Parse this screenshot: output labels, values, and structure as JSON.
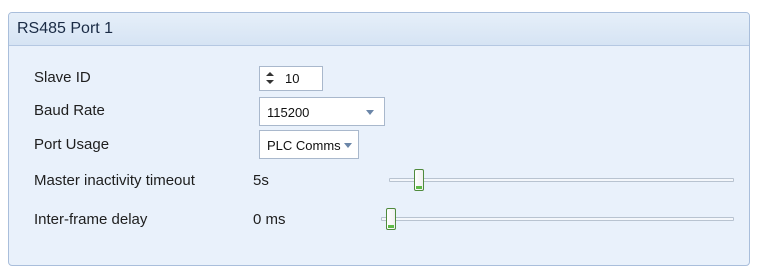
{
  "panel": {
    "title": "RS485 Port 1"
  },
  "slave_id": {
    "label": "Slave ID",
    "value": "10"
  },
  "baud_rate": {
    "label": "Baud Rate",
    "value": "115200"
  },
  "port_usage": {
    "label": "Port Usage",
    "value": "PLC Comms"
  },
  "master_inactivity_timeout": {
    "label": "Master inactivity timeout",
    "value_text": "5s",
    "slider_fraction": 0.06
  },
  "inter_frame_delay": {
    "label": "Inter-frame delay",
    "value_text": "0 ms",
    "slider_fraction": 0.0
  },
  "colors": {
    "panel_background": "#e9f1fb",
    "panel_border": "#a9bedb",
    "slider_thumb_accent": "#5fbb47",
    "dropdown_arrow": "#6b86a8"
  },
  "icons": {
    "spinner": "spinner-arrows-icon",
    "dropdown": "chevron-down-icon"
  }
}
